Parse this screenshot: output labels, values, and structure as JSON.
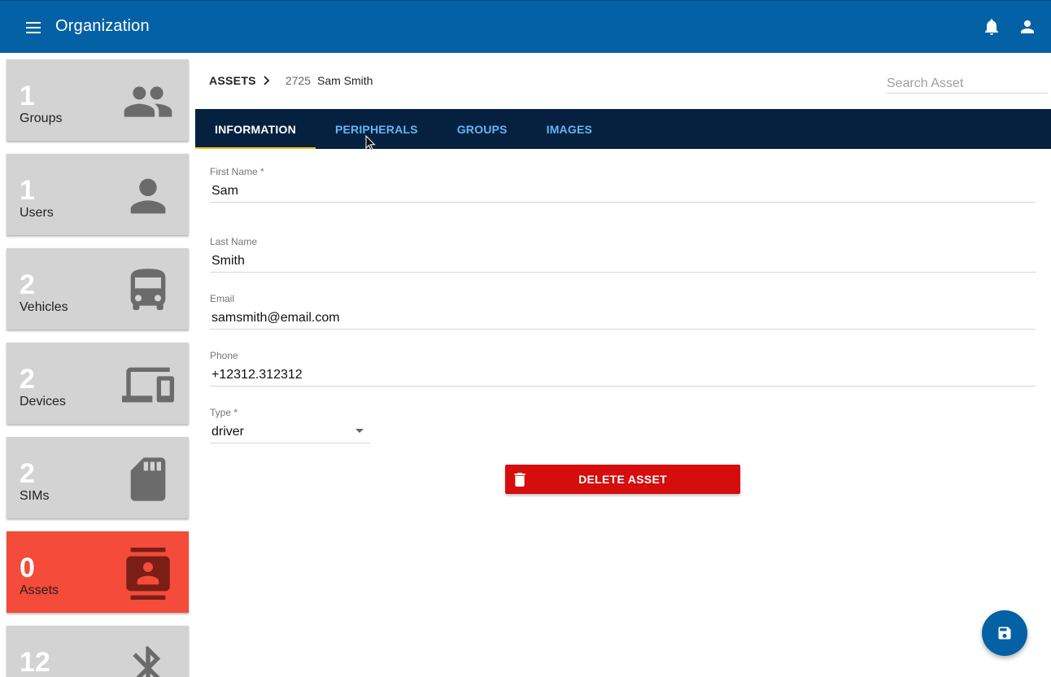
{
  "appbar": {
    "title": "Organization"
  },
  "sidebar": {
    "cards": [
      {
        "count": "1",
        "label": "Groups",
        "icon": "groups-icon"
      },
      {
        "count": "1",
        "label": "Users",
        "icon": "person-icon"
      },
      {
        "count": "2",
        "label": "Vehicles",
        "icon": "bus-icon"
      },
      {
        "count": "2",
        "label": "Devices",
        "icon": "devices-icon"
      },
      {
        "count": "2",
        "label": "SIMs",
        "icon": "sim-card-icon"
      },
      {
        "count": "0",
        "label": "Assets",
        "icon": "contact-card-icon",
        "active": true
      },
      {
        "count": "12",
        "label": "",
        "icon": "bluetooth-icon"
      }
    ],
    "active_color": "#f44b3a",
    "card_color": "#d3d3d3"
  },
  "breadcrumb": {
    "root": "ASSETS",
    "id": "2725",
    "name": "Sam Smith"
  },
  "search": {
    "placeholder": "Search Asset",
    "value": ""
  },
  "tabs": [
    {
      "label": "INFORMATION",
      "active": true
    },
    {
      "label": "PERIPHERALS"
    },
    {
      "label": "GROUPS"
    },
    {
      "label": "IMAGES"
    },
    {
      "label": "",
      "disabled": true
    }
  ],
  "form": {
    "first_name": {
      "label": "First Name *",
      "value": "Sam"
    },
    "last_name": {
      "label": "Last Name",
      "value": "Smith"
    },
    "email": {
      "label": "Email",
      "value": "samsmith@email.com"
    },
    "phone": {
      "label": "Phone",
      "value": "+12312.312312"
    },
    "type": {
      "label": "Type *",
      "value": "driver"
    }
  },
  "actions": {
    "delete_label": "DELETE ASSET",
    "delete_color": "#d50d0d"
  },
  "colors": {
    "primary": "#0561a5",
    "tabbar": "#05213f",
    "tab_indicator": "#f5c518",
    "tab_text": "#64b5f6"
  }
}
